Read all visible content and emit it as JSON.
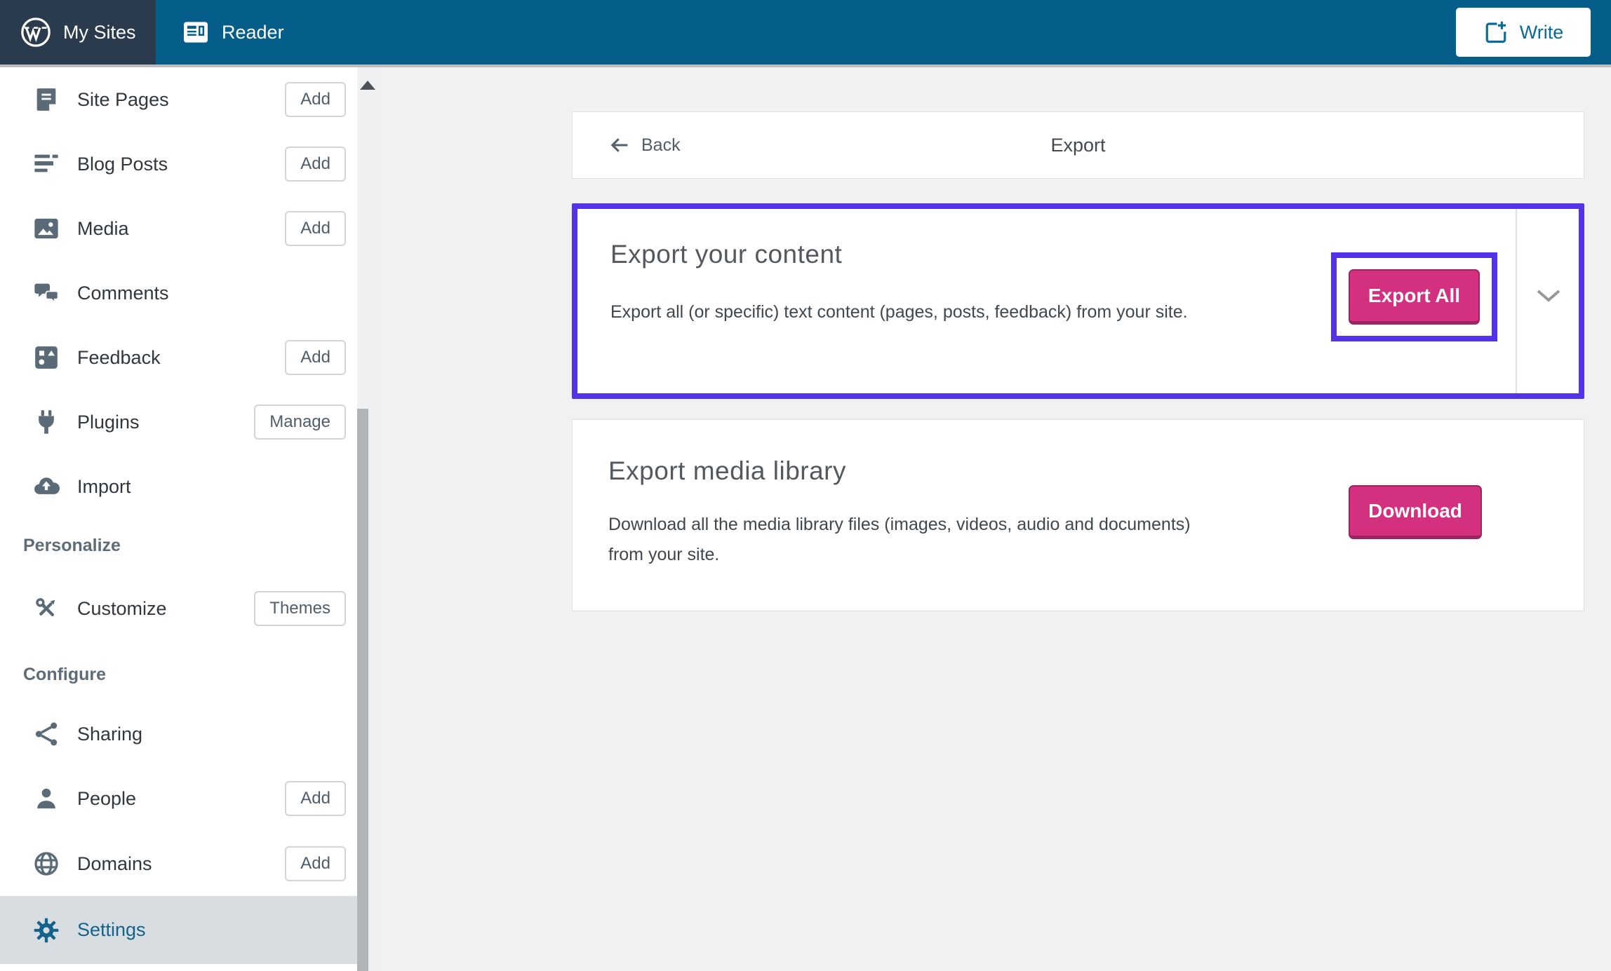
{
  "topbar": {
    "my_sites": "My Sites",
    "reader": "Reader",
    "write": "Write"
  },
  "sidebar": {
    "items": [
      {
        "label": "Site Pages",
        "action": "Add"
      },
      {
        "label": "Blog Posts",
        "action": "Add"
      },
      {
        "label": "Media",
        "action": "Add"
      },
      {
        "label": "Comments",
        "action": ""
      },
      {
        "label": "Feedback",
        "action": "Add"
      },
      {
        "label": "Plugins",
        "action": "Manage"
      },
      {
        "label": "Import",
        "action": ""
      }
    ],
    "sections": {
      "personalize": "Personalize",
      "configure": "Configure"
    },
    "personalize_items": [
      {
        "label": "Customize",
        "action": "Themes"
      }
    ],
    "configure_items": [
      {
        "label": "Sharing",
        "action": ""
      },
      {
        "label": "People",
        "action": "Add"
      },
      {
        "label": "Domains",
        "action": "Add"
      },
      {
        "label": "Settings",
        "action": "",
        "active": true
      }
    ]
  },
  "main": {
    "header": {
      "back": "Back",
      "title": "Export"
    },
    "export_content": {
      "title": "Export your content",
      "description": "Export all (or specific) text content (pages, posts, feedback) from your site.",
      "button": "Export All"
    },
    "export_media": {
      "title": "Export media library",
      "description": "Download all the media library files (images, videos, audio and documents) from your site.",
      "button": "Download"
    }
  },
  "colors": {
    "annotation_purple": "#5432E8",
    "primary_pink": "#D3317F",
    "topbar_teal": "#045E89",
    "topbar_dark": "#2B3B4E",
    "active_row_bg": "#D8DDE2",
    "active_link_teal": "#14638C"
  }
}
